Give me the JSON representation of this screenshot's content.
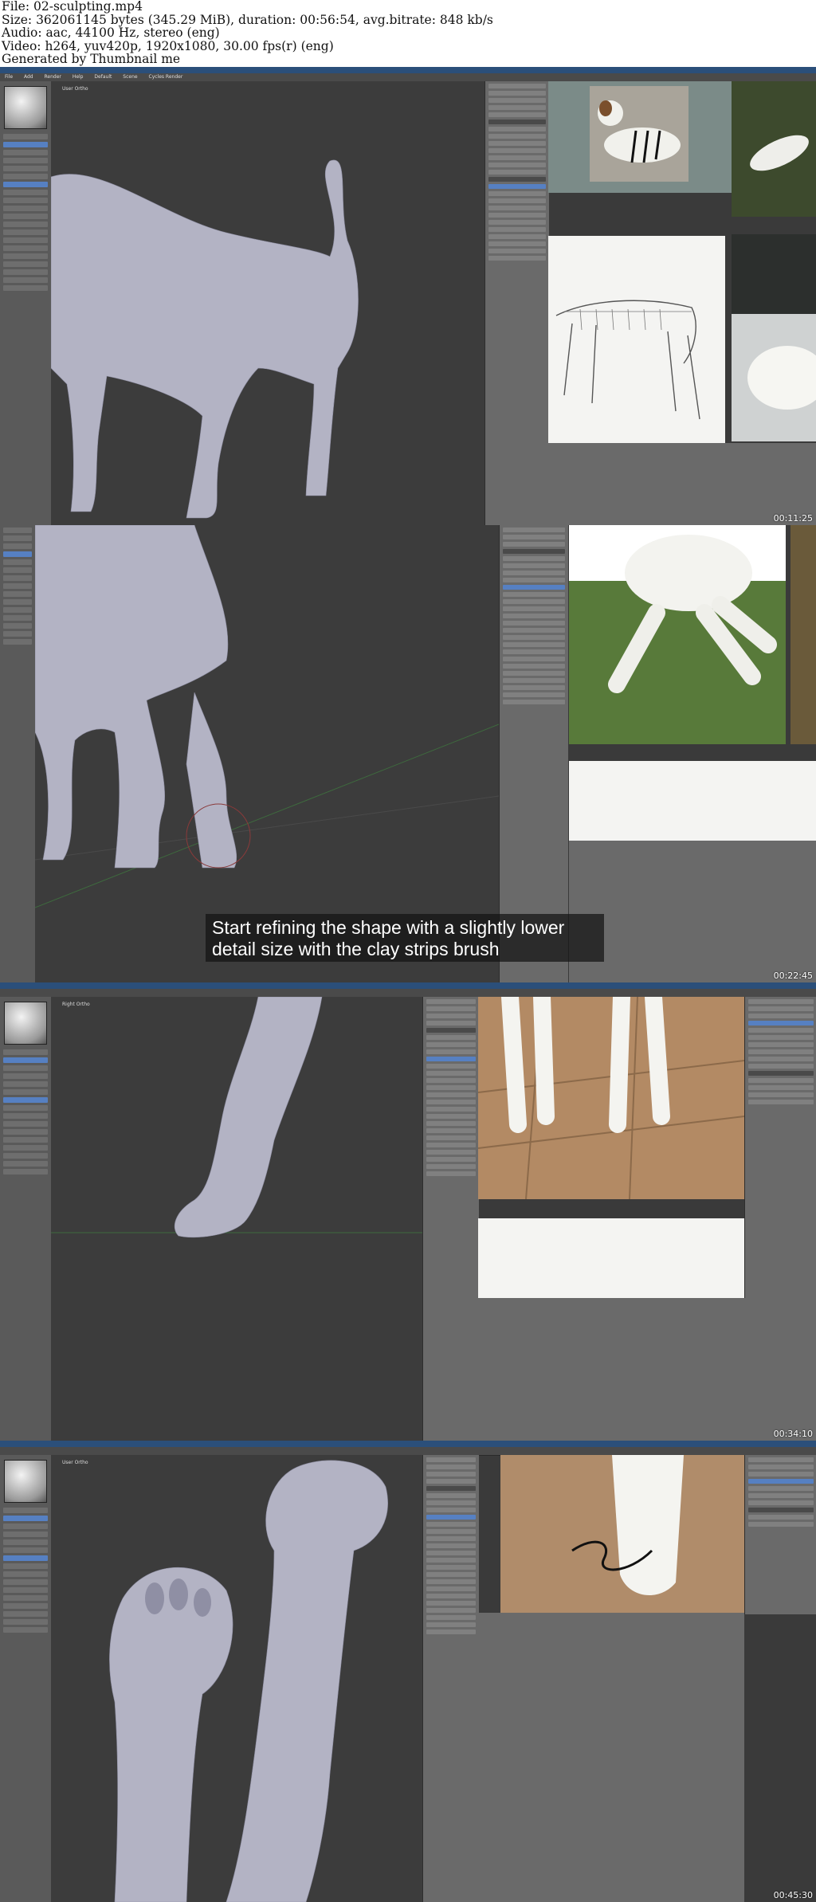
{
  "header": {
    "line1": "File: 02-sculpting.mp4",
    "line2": "Size: 362061145 bytes (345.29 MiB), duration: 00:56:54, avg.bitrate: 848 kb/s",
    "line3": "Audio: aac, 44100 Hz, stereo (eng)",
    "line4": "Video: h264, yuv420p, 1920x1080, 30.00 fps(r) (eng)",
    "line5": "Generated by Thumbnail me"
  },
  "frames": [
    {
      "timestamp": "00:11:25",
      "viewport_label": "User Ortho"
    },
    {
      "timestamp": "00:22:45",
      "caption": "Start refining the shape with a slightly lower detail size with the clay strips brush"
    },
    {
      "timestamp": "00:34:10",
      "viewport_label": "Right Ortho"
    },
    {
      "timestamp": "00:45:30",
      "viewport_label": "User Ortho"
    }
  ],
  "menu": [
    "File",
    "Add",
    "Render",
    "Help",
    "Default",
    "Scene",
    "Cycles Render"
  ],
  "colors": {
    "mesh": "#b3b3c4",
    "viewport": "#3c3c3c",
    "panel": "#6a6a6a",
    "titlebar": "#2b4f7a"
  },
  "icons": [
    "brush-thumbnail-icon",
    "grid-icon"
  ]
}
